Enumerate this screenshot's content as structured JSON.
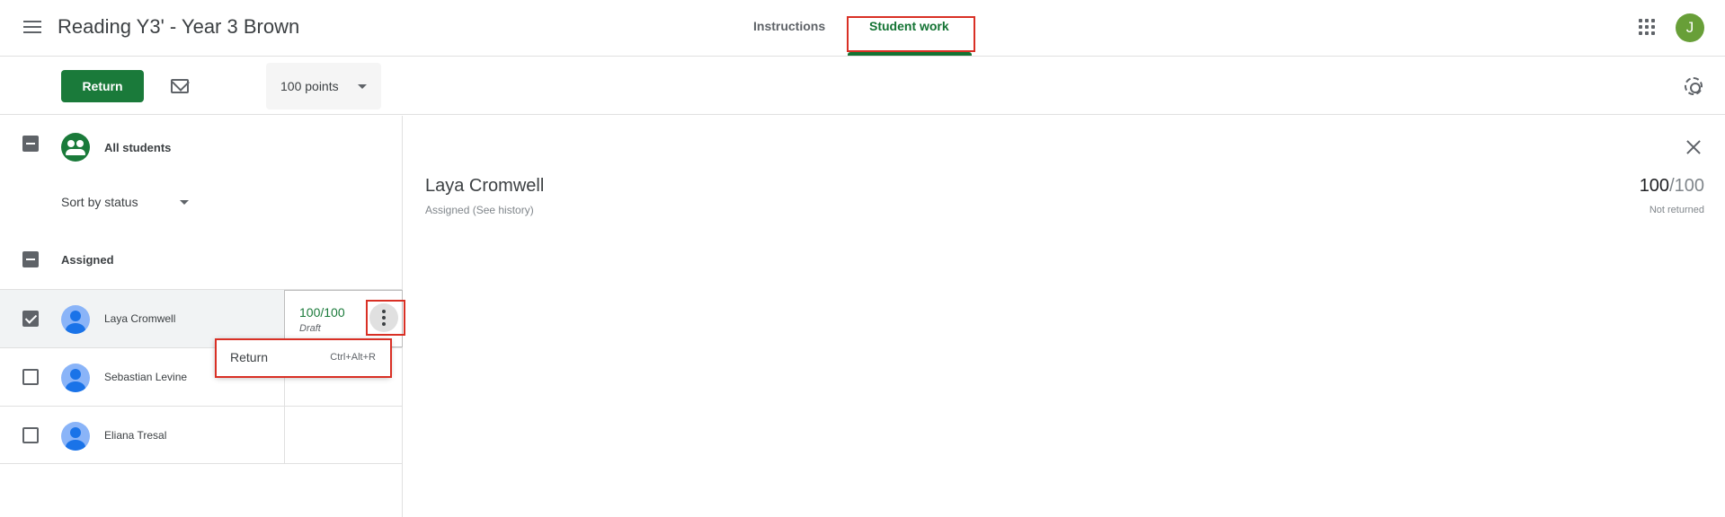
{
  "header": {
    "title": "Reading Y3' - Year 3 Brown",
    "tabs": [
      {
        "label": "Instructions",
        "active": false
      },
      {
        "label": "Student work",
        "active": true
      }
    ],
    "user_initial": "J"
  },
  "toolbar": {
    "return_label": "Return",
    "points_value": "100 points"
  },
  "students_panel": {
    "all_students_label": "All students",
    "sort_label": "Sort by status",
    "group_label": "Assigned",
    "students": [
      {
        "name": "Laya Cromwell",
        "checked": true,
        "grade": "100/100",
        "status": "Draft"
      },
      {
        "name": "Sebastian Levine",
        "checked": false,
        "grade": "",
        "status": ""
      },
      {
        "name": "Eliana Tresal",
        "checked": false,
        "grade": "",
        "status": ""
      }
    ]
  },
  "context_menu": {
    "item_label": "Return",
    "item_shortcut": "Ctrl+Alt+R"
  },
  "detail": {
    "student_name": "Laya Cromwell",
    "status": "Assigned (See history)",
    "grade_numerator": "100",
    "grade_denominator": "/100",
    "returned_status": "Not returned"
  },
  "colors": {
    "brand_green": "#1a7a3a",
    "highlight_red": "#d93025"
  }
}
